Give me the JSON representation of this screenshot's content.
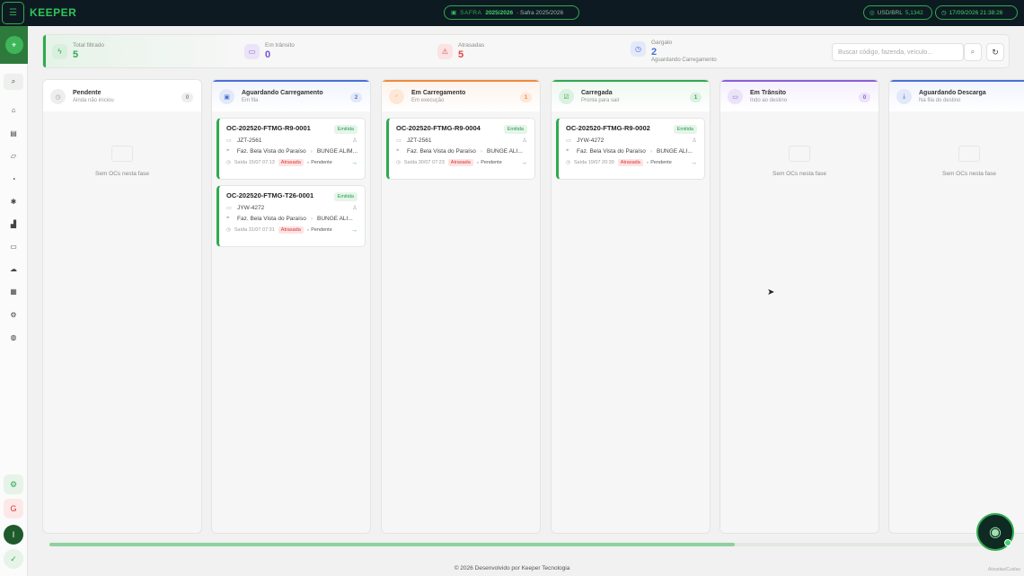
{
  "app": {
    "logo": "KEEPER"
  },
  "topbar": {
    "safra_label": "SAFRA",
    "safra_value": "2025/2026",
    "safra_desc": "· Safra 2025/2026",
    "usd_label": "USD/BRL",
    "usd_value": "5,1342",
    "datetime": "17/09/2026 21:38:26"
  },
  "kpis": [
    {
      "label": "Total filtrado",
      "value": "5",
      "sub": "",
      "color": "#2faa4f",
      "icon": "lightning-icon"
    },
    {
      "label": "Em trânsito",
      "value": "0",
      "sub": "",
      "color": "#7b4fd0",
      "icon": "truck-icon"
    },
    {
      "label": "Atrasadas",
      "value": "5",
      "sub": "",
      "color": "#e04545",
      "icon": "warning-icon"
    },
    {
      "label": "Gargalo",
      "value": "2",
      "sub": "Aguardando Carregamento",
      "color": "#4a6fd8",
      "icon": "clock-icon"
    }
  ],
  "search": {
    "placeholder": "Buscar código, fazenda, veículo..."
  },
  "columns": [
    {
      "title": "Pendente",
      "sub": "Ainda não iniciou",
      "count": "0",
      "color": "#999999",
      "empty_text": "Sem OCs nesta fase"
    },
    {
      "title": "Aguardando Carregamento",
      "sub": "Em fila",
      "count": "2",
      "color": "#4a6fd8",
      "empty_text": ""
    },
    {
      "title": "Em Carregamento",
      "sub": "Em execução",
      "count": "1",
      "color": "#f08a3c",
      "empty_text": ""
    },
    {
      "title": "Carregada",
      "sub": "Pronta para sair",
      "count": "1",
      "color": "#2faa4f",
      "empty_text": ""
    },
    {
      "title": "Em Trânsito",
      "sub": "Indo ao destino",
      "count": "0",
      "color": "#8a5fd8",
      "empty_text": "Sem OCs nesta fase"
    },
    {
      "title": "Aguardando Descarga",
      "sub": "Na fila do destino",
      "count": "",
      "color": "#4a6fd8",
      "empty_text": "Sem OCs nesta fase"
    }
  ],
  "cards": [
    {
      "code": "OC-202520-FTMG-R9-0001",
      "badge": "Emitida",
      "plate": "JZT-2561",
      "farm": "Faz. Bela Vista do Paraíso",
      "dest": "BUNGE ALIM...",
      "saida": "Saída 15/07 07:13",
      "late": "Atrasada",
      "status": "Pendente"
    },
    {
      "code": "OC-202520-FTMG-T26-0001",
      "badge": "Emitida",
      "plate": "JYW-4272",
      "farm": "Faz. Bela Vista do Paraíso",
      "dest": "BUNGE ALI...",
      "saida": "Saída 31/07 07:31",
      "late": "Atrasada",
      "status": "Pendente"
    },
    {
      "code": "OC-202520-FTMG-R9-0004",
      "badge": "Emitida",
      "plate": "JZT-2561",
      "farm": "Faz. Bela Vista do Paraíso",
      "dest": "BUNGE ALI...",
      "saida": "Saída 30/07 07:23",
      "late": "Atrasada",
      "status": "Pendente"
    },
    {
      "code": "OC-202520-FTMG-R9-0002",
      "badge": "Emitida",
      "plate": "JYW-4272",
      "farm": "Faz. Bela Vista do Paraíso",
      "dest": "BUNGE ALI...",
      "saida": "Saída 19/07 20:30",
      "late": "Atrasada",
      "status": "Pendente"
    }
  ],
  "sidebar_bottom": {
    "letter_g": "G",
    "avatar": "I"
  },
  "footer": {
    "text": "© 2026 Desenvolvido por Keeper Tecnologia",
    "right": "Ativadas/Cuidas"
  },
  "scroll": {
    "position_fraction": 0.72
  }
}
